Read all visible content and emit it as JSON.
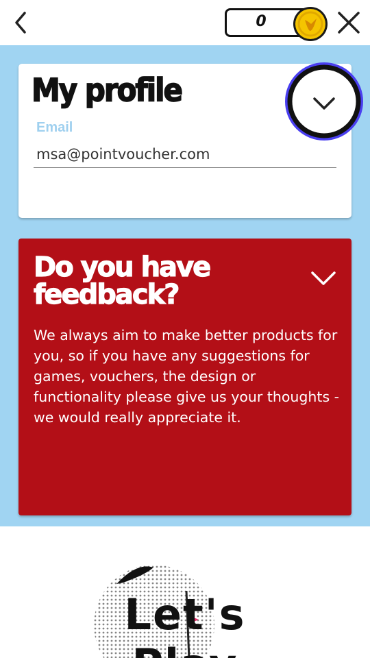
{
  "header": {
    "back_icon": "chevron-left-icon",
    "points": "0",
    "coin_icon": "voucher-coin-icon",
    "close_icon": "close-icon"
  },
  "profile": {
    "title": "My profile",
    "email_label": "Email",
    "email_value": "msa@pointvoucher.com",
    "toggle_icon": "chevron-down-icon"
  },
  "feedback": {
    "title": "Do you have feedback?",
    "body": "We always aim to make better products for you, so if you have any suggestions for games, vouchers, the design or functionality please give us your thoughts - we would really appreciate it.",
    "toggle_icon": "chevron-down-icon"
  },
  "footer": {
    "play_label": "Let's Play"
  },
  "colors": {
    "background": "#a0d4f2",
    "feedback_card": "#b30f17",
    "email_label": "#9fd0ef",
    "focus_ring": "#4a3ff0",
    "coin": "#f5c400"
  }
}
